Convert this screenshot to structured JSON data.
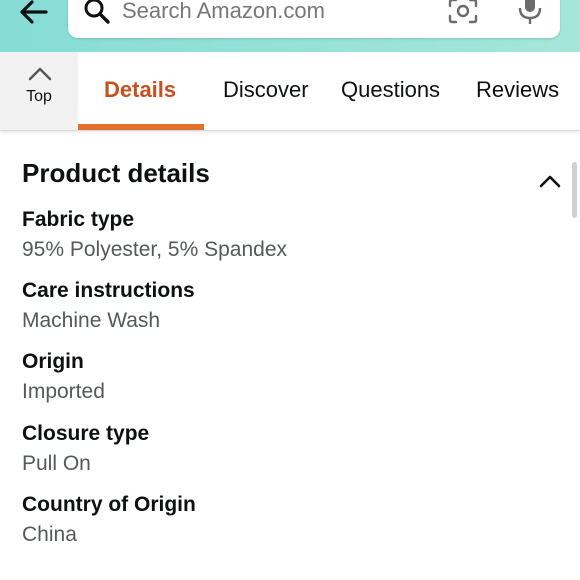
{
  "header": {
    "search_placeholder": "Search Amazon.com",
    "colors": {
      "gradient_start": "#86dcd6",
      "gradient_end": "#a5e6d9"
    }
  },
  "tabs": {
    "top_label": "Top",
    "items": [
      {
        "label": "Details",
        "active": true
      },
      {
        "label": "Discover",
        "active": false
      },
      {
        "label": "Questions",
        "active": false
      },
      {
        "label": "Reviews",
        "active": false
      }
    ],
    "active_color": "#c7511f",
    "underline_color": "#e3702a"
  },
  "product_details": {
    "title": "Product details",
    "rows": [
      {
        "label": "Fabric type",
        "value": "95% Polyester, 5% Spandex"
      },
      {
        "label": "Care instructions",
        "value": "Machine Wash"
      },
      {
        "label": "Origin",
        "value": "Imported"
      },
      {
        "label": "Closure type",
        "value": "Pull On"
      },
      {
        "label": "Country of Origin",
        "value": "China"
      }
    ]
  },
  "icons": {
    "back": "back-arrow-icon",
    "search": "search-icon",
    "camera": "camera-lens-icon",
    "mic": "microphone-icon",
    "top": "chevron-up-icon",
    "collapse": "chevron-up-icon"
  }
}
